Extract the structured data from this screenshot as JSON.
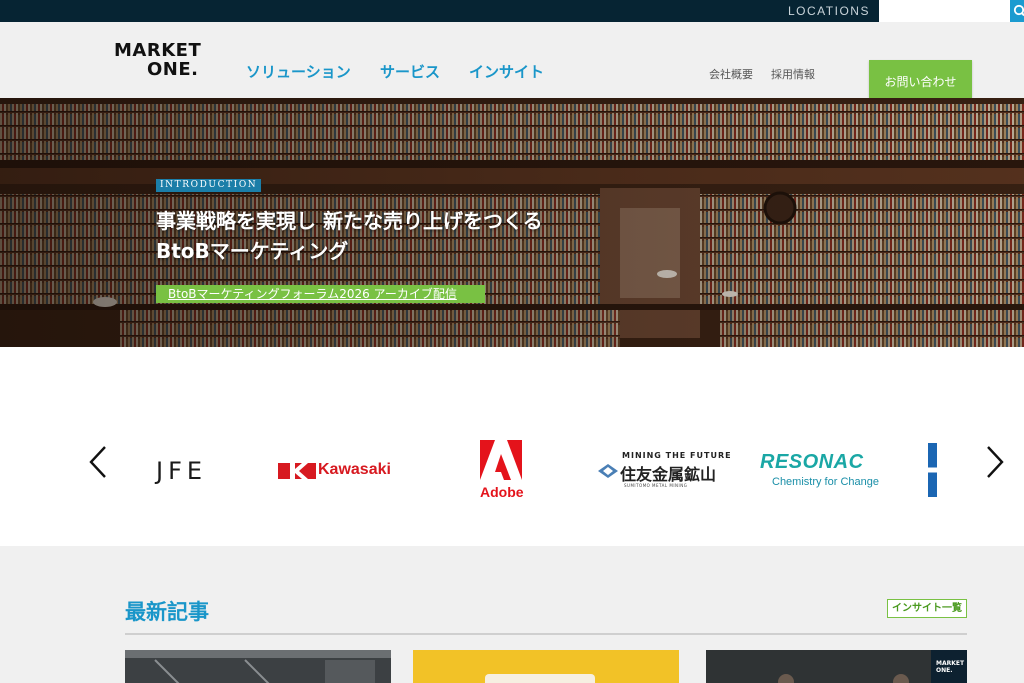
{
  "topbar": {
    "locations_label": "LOCATIONS",
    "search_placeholder": "",
    "search_value": ""
  },
  "header": {
    "logo_line1": "MARKET",
    "logo_line2": "ONE.",
    "nav": [
      {
        "label": "ソリューション"
      },
      {
        "label": "サービス"
      },
      {
        "label": "インサイト"
      }
    ],
    "sub_nav": [
      {
        "label": "会社概要"
      },
      {
        "label": "採用情報"
      }
    ],
    "contact_label": "お問い合わせ"
  },
  "hero": {
    "badge": "INTRODUCTION",
    "title_line1": "事業戦略を実現し 新たな売り上げをつくる",
    "title_line2": "BtoBマーケティング",
    "cta_label": "BtoBマーケティングフォーラム2026 アーカイブ配信"
  },
  "clients": {
    "jfe": "JFE",
    "kawasaki": "Kawasaki",
    "adobe": "Adobe",
    "sumitomo_tagline": "MINING THE FUTURE",
    "sumitomo_name": "住友金属鉱山",
    "sumitomo_sub": "SUMITOMO METAL MINING",
    "resonac_name": "RESONAC",
    "resonac_tagline": "Chemistry for Change"
  },
  "latest": {
    "title": "最新記事",
    "insight_link": "インサイト一覧",
    "card_logo_line1": "MARKET",
    "card_logo_line2": "ONE."
  },
  "colors": {
    "brand_blue": "#1a96c9",
    "brand_green": "#79c143",
    "topbar_navy": "#062433"
  }
}
